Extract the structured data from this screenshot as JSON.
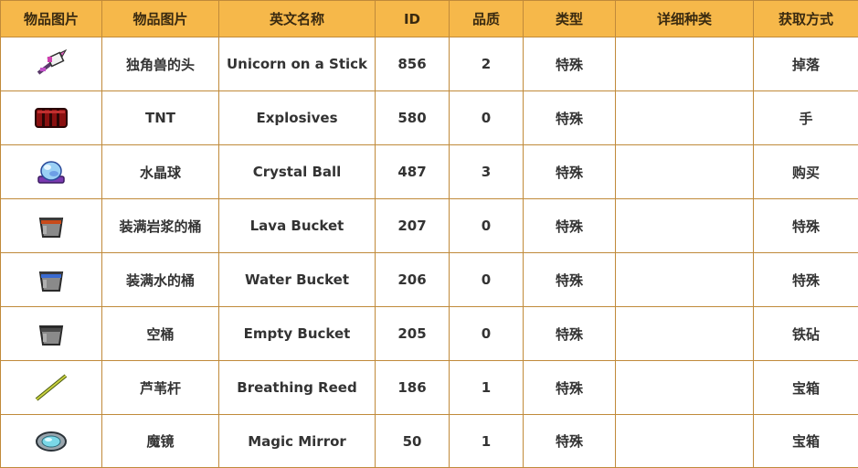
{
  "headers": [
    "物品图片",
    "物品图片",
    "英文名称",
    "ID",
    "品质",
    "类型",
    "详细种类",
    "获取方式"
  ],
  "rows": [
    {
      "icon": "unicorn-on-a-stick-icon",
      "cn_name": "独角兽的头",
      "en_name": "Unicorn on a Stick",
      "id": "856",
      "rarity": "2",
      "type": "特殊",
      "subtype": "",
      "source": "掉落"
    },
    {
      "icon": "tnt-explosives-icon",
      "cn_name": "TNT",
      "en_name": "Explosives",
      "id": "580",
      "rarity": "0",
      "type": "特殊",
      "subtype": "",
      "source": "手"
    },
    {
      "icon": "crystal-ball-icon",
      "cn_name": "水晶球",
      "en_name": "Crystal Ball",
      "id": "487",
      "rarity": "3",
      "type": "特殊",
      "subtype": "",
      "source": "购买"
    },
    {
      "icon": "lava-bucket-icon",
      "cn_name": "装满岩浆的桶",
      "en_name": "Lava Bucket",
      "id": "207",
      "rarity": "0",
      "type": "特殊",
      "subtype": "",
      "source": "特殊"
    },
    {
      "icon": "water-bucket-icon",
      "cn_name": "装满水的桶",
      "en_name": "Water Bucket",
      "id": "206",
      "rarity": "0",
      "type": "特殊",
      "subtype": "",
      "source": "特殊"
    },
    {
      "icon": "empty-bucket-icon",
      "cn_name": "空桶",
      "en_name": "Empty Bucket",
      "id": "205",
      "rarity": "0",
      "type": "特殊",
      "subtype": "",
      "source": "铁砧"
    },
    {
      "icon": "breathing-reed-icon",
      "cn_name": "芦苇杆",
      "en_name": "Breathing Reed",
      "id": "186",
      "rarity": "1",
      "type": "特殊",
      "subtype": "",
      "source": "宝箱"
    },
    {
      "icon": "magic-mirror-icon",
      "cn_name": "魔镜",
      "en_name": "Magic Mirror",
      "id": "50",
      "rarity": "1",
      "type": "特殊",
      "subtype": "",
      "source": "宝箱"
    }
  ],
  "colors": {
    "header_bg": "#f6b84a",
    "border": "#c08a3a",
    "row_bg": "#ffffff"
  }
}
